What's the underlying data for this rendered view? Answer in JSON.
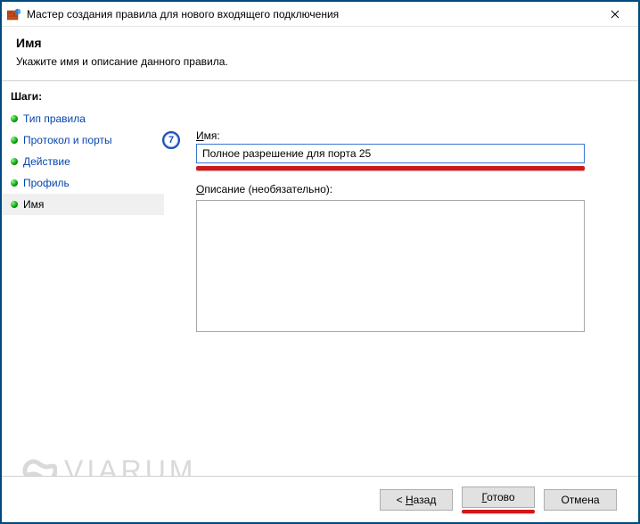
{
  "window": {
    "title": "Мастер создания правила для нового входящего подключения"
  },
  "header": {
    "title": "Имя",
    "subtitle": "Укажите имя и описание данного правила."
  },
  "sidebar": {
    "steps_label": "Шаги:",
    "items": [
      {
        "label": "Тип правила"
      },
      {
        "label": "Протокол и порты"
      },
      {
        "label": "Действие"
      },
      {
        "label": "Профиль"
      },
      {
        "label": "Имя"
      }
    ]
  },
  "form": {
    "badge_num": "7",
    "name_label": "Имя:",
    "name_label_u": "И",
    "name_label_rest": "мя:",
    "name_value": "Полное разрешение для порта 25",
    "desc_label": "Описание (необязательно):",
    "desc_label_u": "О",
    "desc_label_rest": "писание (необязательно):",
    "desc_value": ""
  },
  "footer": {
    "back": "< Назад",
    "back_u": "Н",
    "finish": "Готово",
    "finish_u": "Г",
    "cancel": "Отмена"
  },
  "watermark": {
    "text": "VIARUM"
  }
}
